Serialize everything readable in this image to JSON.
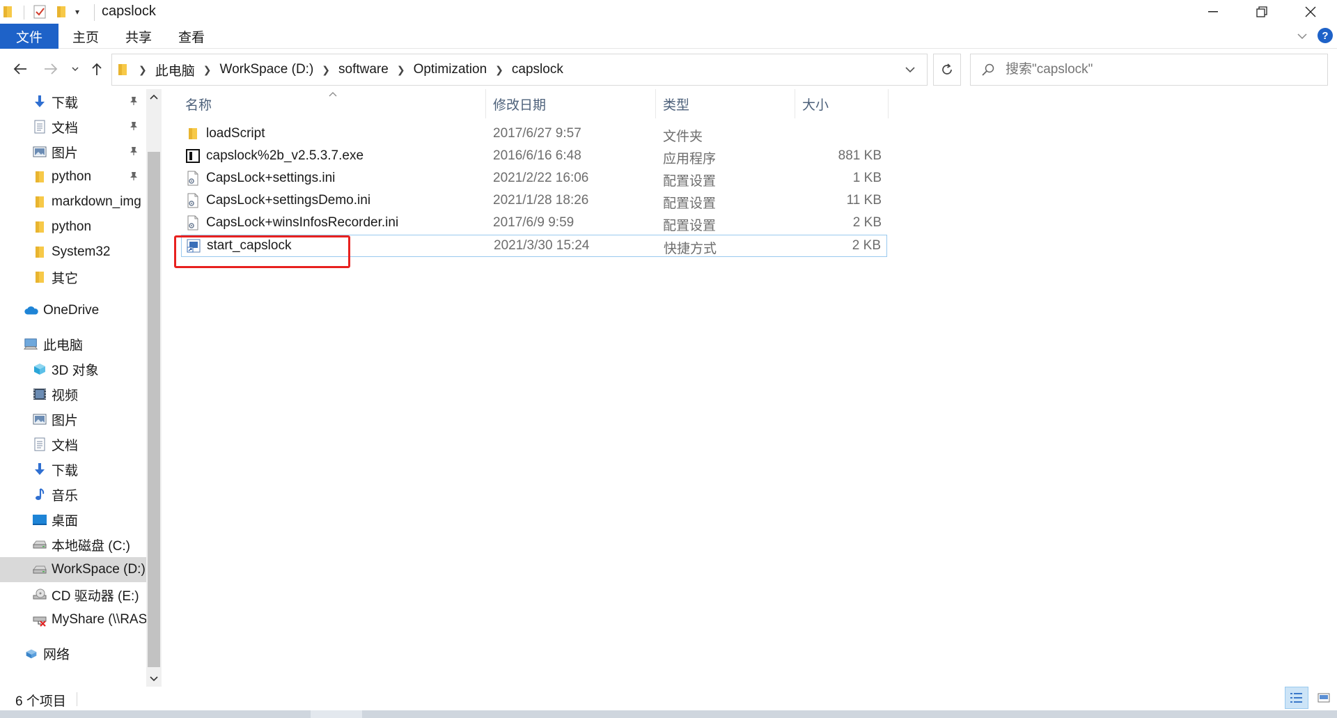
{
  "window": {
    "title": "capslock",
    "minimize_glyph": "—",
    "restore_glyph": "❐",
    "close_glyph": "✕"
  },
  "ribbon": {
    "tabs": [
      "文件",
      "主页",
      "共享",
      "查看"
    ],
    "help": "?"
  },
  "address": {
    "crumbs": [
      "此电脑",
      "WorkSpace (D:)",
      "software",
      "Optimization",
      "capslock"
    ]
  },
  "search": {
    "placeholder": "搜索\"capslock\""
  },
  "nav_pane": {
    "quick_access": [
      {
        "label": "下载",
        "icon": "download-icon",
        "pinned": true
      },
      {
        "label": "文档",
        "icon": "document-icon",
        "pinned": true
      },
      {
        "label": "图片",
        "icon": "pictures-icon",
        "pinned": true
      },
      {
        "label": "python",
        "icon": "folder-icon",
        "pinned": true
      },
      {
        "label": "markdown_img",
        "icon": "folder-icon",
        "pinned": false
      },
      {
        "label": "python",
        "icon": "folder-icon",
        "pinned": false
      },
      {
        "label": "System32",
        "icon": "folder-icon",
        "pinned": false
      },
      {
        "label": "其它",
        "icon": "folder-icon",
        "pinned": false
      }
    ],
    "onedrive": "OneDrive",
    "this_pc": "此电脑",
    "pc_items": [
      {
        "label": "3D 对象",
        "icon": "3d-objects-icon"
      },
      {
        "label": "视频",
        "icon": "video-icon"
      },
      {
        "label": "图片",
        "icon": "pictures-icon"
      },
      {
        "label": "文档",
        "icon": "document-icon"
      },
      {
        "label": "下载",
        "icon": "download-icon"
      },
      {
        "label": "音乐",
        "icon": "music-icon"
      },
      {
        "label": "桌面",
        "icon": "desktop-icon"
      },
      {
        "label": "本地磁盘 (C:)",
        "icon": "drive-icon"
      },
      {
        "label": "WorkSpace (D:)",
        "icon": "drive-icon",
        "selected": true
      },
      {
        "label": "CD 驱动器 (E:)",
        "icon": "cd-drive-icon"
      },
      {
        "label": "MyShare (\\\\RAS",
        "icon": "network-drive-disconnected-icon"
      }
    ],
    "network": "网络"
  },
  "columns": {
    "name": "名称",
    "modified": "修改日期",
    "type": "类型",
    "size": "大小"
  },
  "files": [
    {
      "name": "loadScript",
      "modified": "2017/6/27 9:57",
      "type": "文件夹",
      "size": "",
      "icon": "folder-icon"
    },
    {
      "name": "capslock%2b_v2.5.3.7.exe",
      "modified": "2016/6/16 6:48",
      "type": "应用程序",
      "size": "881 KB",
      "icon": "exe-icon"
    },
    {
      "name": "CapsLock+settings.ini",
      "modified": "2021/2/22 16:06",
      "type": "配置设置",
      "size": "1 KB",
      "icon": "ini-file-icon"
    },
    {
      "name": "CapsLock+settingsDemo.ini",
      "modified": "2021/1/28 18:26",
      "type": "配置设置",
      "size": "11 KB",
      "icon": "ini-file-icon"
    },
    {
      "name": "CapsLock+winsInfosRecorder.ini",
      "modified": "2017/6/9 9:59",
      "type": "配置设置",
      "size": "2 KB",
      "icon": "ini-file-icon"
    },
    {
      "name": "start_capslock",
      "modified": "2021/3/30 15:24",
      "type": "快捷方式",
      "size": "2 KB",
      "icon": "shortcut-icon",
      "selected": true
    }
  ],
  "status": {
    "item_count": "6 个项目"
  },
  "colors": {
    "accent": "#1e62c8",
    "selection_border": "#99c9ef",
    "highlight_box": "#e8211f",
    "column_header_text": "#4c607a",
    "folder_yellow": "#f7c948"
  }
}
